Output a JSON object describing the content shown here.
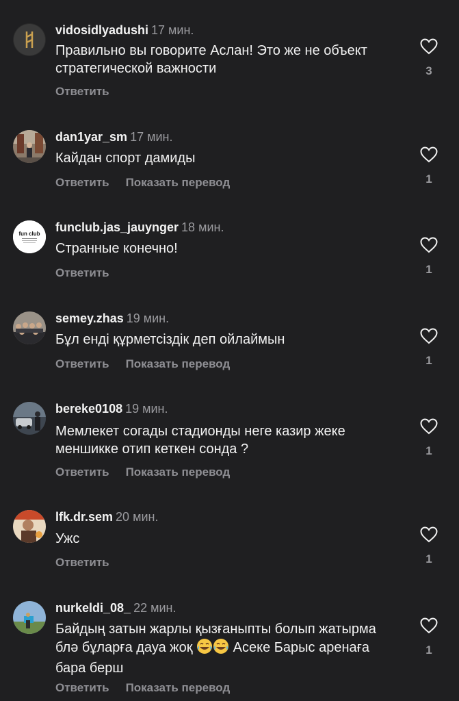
{
  "icons": {
    "like": "heart-outline-icon",
    "emoji": "face-with-tears-of-joy-icon"
  },
  "labels": {
    "reply": "Ответить",
    "translate": "Показать перевод"
  },
  "comments": [
    {
      "username": "vidosidlyadushi",
      "time": "17 мин.",
      "text": "Правильно вы говорите Аслан! Это же не объект стратегической важности",
      "likes": "3"
    },
    {
      "username": "dan1yar_sm",
      "time": "17 мин.",
      "text": "Кайдан спорт дамиды",
      "likes": "1"
    },
    {
      "username": "funclub.jas_jauynger",
      "time": "18 мин.",
      "text": "Странные конечно!",
      "likes": "1",
      "avatar_text": "fun club"
    },
    {
      "username": "semey.zhas",
      "time": "19 мин.",
      "text": "Бұл енді құрметсіздік деп ойлаймын",
      "likes": "1"
    },
    {
      "username": "bereke0108",
      "time": "19 мин.",
      "text": "Мемлекет согады стадионды неге казир жеке меншикке отип кеткен  сонда ?",
      "likes": "1"
    },
    {
      "username": "lfk.dr.sem",
      "time": "20 мин.",
      "text": "Ужс",
      "likes": "1"
    },
    {
      "username": "nurkeldi_08_",
      "time": "22 мин.",
      "text_before": "Байдың затын жарлы қызғаныпты болып жатырма блә бұларға дауа жоқ",
      "text_after": "Асеке Барыс аренаға бара берш",
      "likes": "1"
    }
  ]
}
